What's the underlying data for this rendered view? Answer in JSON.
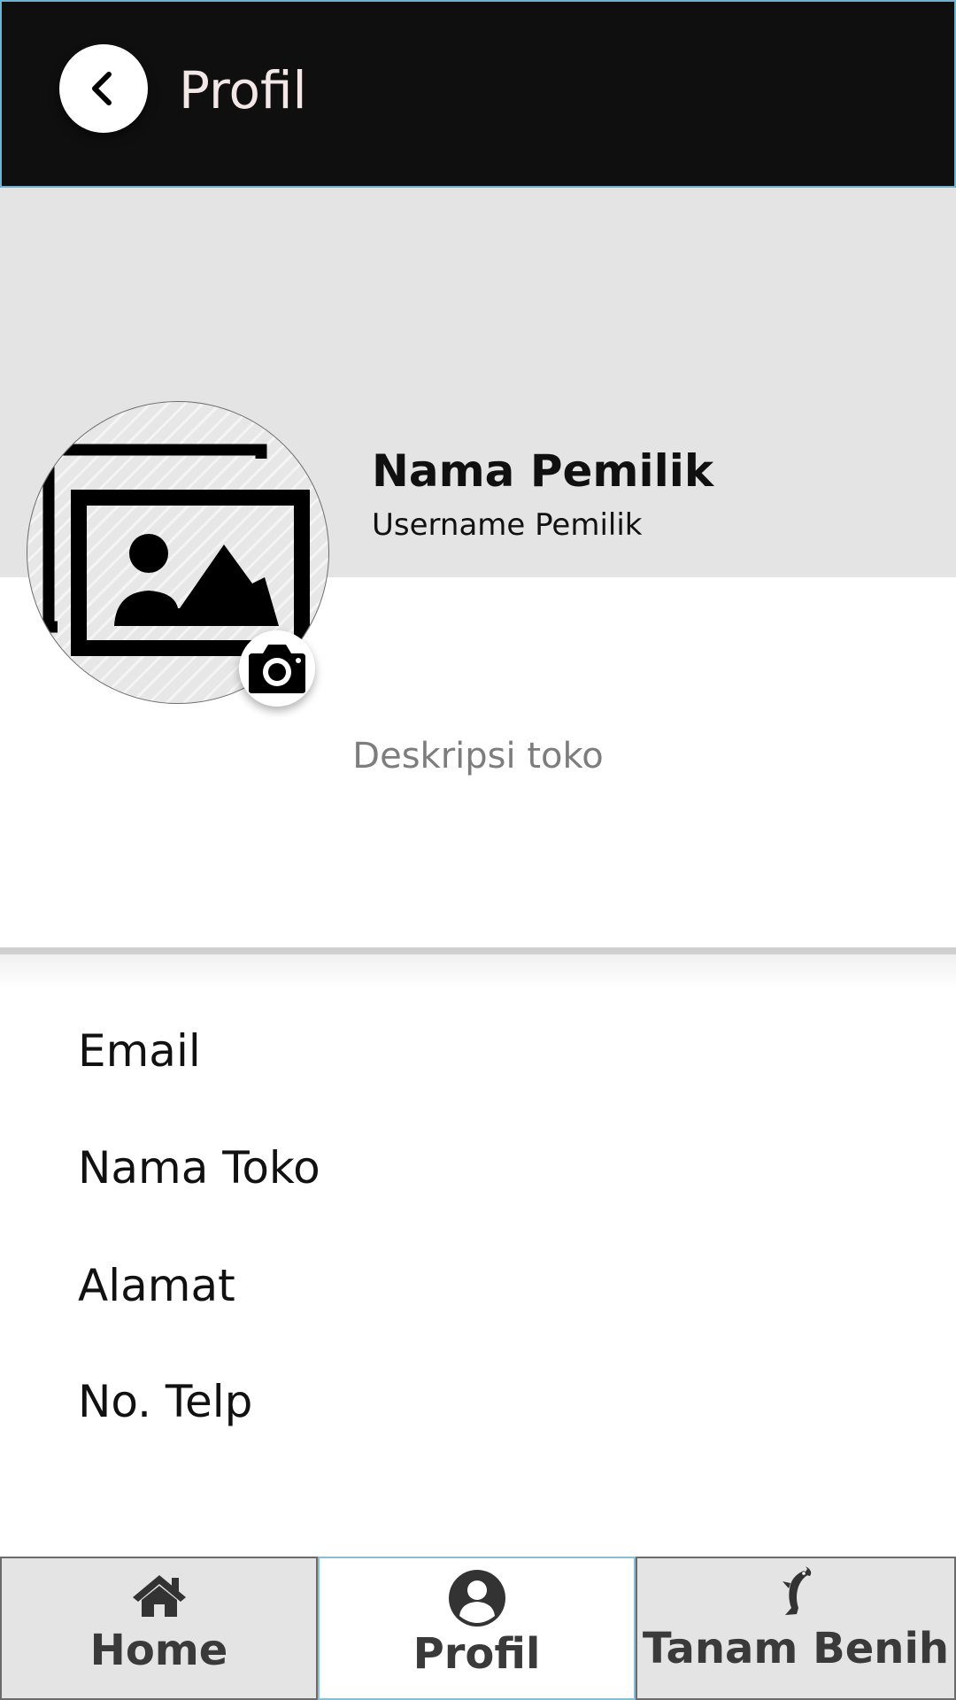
{
  "header": {
    "title": "Profil",
    "back_icon": "chevron-left-icon",
    "background": "#0f0f0f",
    "border_color": "#6fb3cf"
  },
  "profile": {
    "owner_name": "Nama Pemilik",
    "owner_username": "Username Pemilik",
    "avatar_icon": "image-placeholder-icon",
    "camera_icon": "camera-icon",
    "description_placeholder": "Deskripsi toko"
  },
  "info_fields": [
    {
      "label": "Email"
    },
    {
      "label": "Nama Toko"
    },
    {
      "label": "Alamat"
    },
    {
      "label": "No. Telp"
    }
  ],
  "bottom_nav": {
    "items": [
      {
        "label": "Home",
        "icon": "home-icon",
        "active": false
      },
      {
        "label": "Profil",
        "icon": "user-icon",
        "active": true
      },
      {
        "label": "Tanam Benih",
        "icon": "fish-icon",
        "active": false
      }
    ],
    "active_color": "#ffffff",
    "inactive_color": "#e4e4e4"
  }
}
